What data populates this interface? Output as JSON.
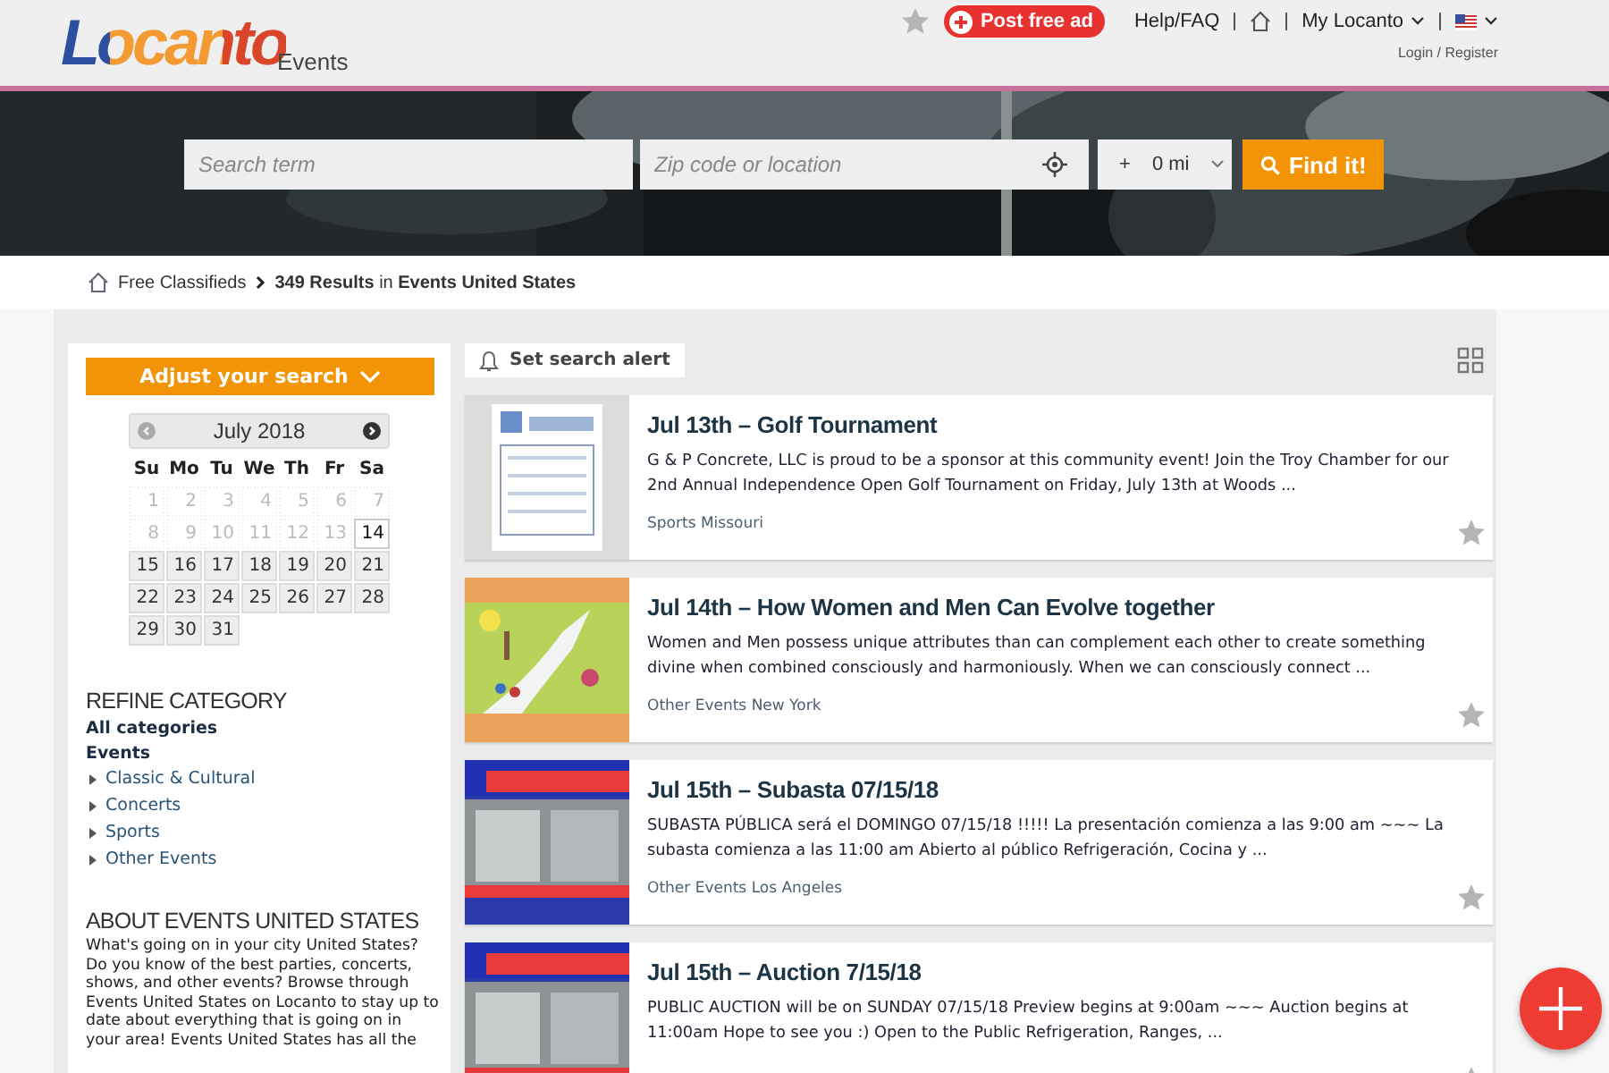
{
  "header": {
    "logo": "Locanto",
    "section": "Events",
    "post_button": "Post free ad",
    "help_link": "Help/FAQ",
    "account_menu": "My Locanto",
    "login_link": "Login / Register"
  },
  "search": {
    "term_placeholder": "Search term",
    "location_placeholder": "Zip code or location",
    "radius_prefix": "+",
    "radius": "0 mi",
    "button": "Find it!"
  },
  "breadcrumb": {
    "home": "Free Classifieds",
    "results": "**349 Results** in **Events United States**"
  },
  "sidebar": {
    "adjust_button": "Adjust your search",
    "calendar": {
      "month": "July 2018",
      "weekdays": [
        "Su",
        "Mo",
        "Tu",
        "We",
        "Th",
        "Fr",
        "Sa"
      ],
      "days": [
        {
          "label": "1",
          "disabled": true,
          "selected": false
        },
        {
          "label": "2",
          "disabled": true,
          "selected": false
        },
        {
          "label": "3",
          "disabled": true,
          "selected": false
        },
        {
          "label": "4",
          "disabled": true,
          "selected": false
        },
        {
          "label": "5",
          "disabled": true,
          "selected": false
        },
        {
          "label": "6",
          "disabled": true,
          "selected": false
        },
        {
          "label": "7",
          "disabled": true,
          "selected": false
        },
        {
          "label": "8",
          "disabled": true,
          "selected": false
        },
        {
          "label": "9",
          "disabled": true,
          "selected": false
        },
        {
          "label": "10",
          "disabled": true,
          "selected": false
        },
        {
          "label": "11",
          "disabled": true,
          "selected": false
        },
        {
          "label": "12",
          "disabled": true,
          "selected": false
        },
        {
          "label": "13",
          "disabled": true,
          "selected": false
        },
        {
          "label": "14",
          "disabled": false,
          "selected": true
        },
        {
          "label": "15",
          "disabled": false,
          "selected": false
        },
        {
          "label": "16",
          "disabled": false,
          "selected": false
        },
        {
          "label": "17",
          "disabled": false,
          "selected": false
        },
        {
          "label": "18",
          "disabled": false,
          "selected": false
        },
        {
          "label": "19",
          "disabled": false,
          "selected": false
        },
        {
          "label": "20",
          "disabled": false,
          "selected": false
        },
        {
          "label": "21",
          "disabled": false,
          "selected": false
        },
        {
          "label": "22",
          "disabled": false,
          "selected": false
        },
        {
          "label": "23",
          "disabled": false,
          "selected": false
        },
        {
          "label": "24",
          "disabled": false,
          "selected": false
        },
        {
          "label": "25",
          "disabled": false,
          "selected": false
        },
        {
          "label": "26",
          "disabled": false,
          "selected": false
        },
        {
          "label": "27",
          "disabled": false,
          "selected": false
        },
        {
          "label": "28",
          "disabled": false,
          "selected": false
        },
        {
          "label": "29",
          "disabled": false,
          "selected": false
        },
        {
          "label": "30",
          "disabled": false,
          "selected": false
        },
        {
          "label": "31",
          "disabled": false,
          "selected": false
        }
      ]
    },
    "refine_title": "REFINE CATEGORY",
    "categories": [
      {
        "label": "All categories"
      },
      {
        "label": "Events",
        "children": [
          {
            "label": "Classic & Cultural"
          },
          {
            "label": "Concerts"
          },
          {
            "label": "Sports"
          },
          {
            "label": "Other Events"
          }
        ]
      }
    ],
    "about_title": "ABOUT EVENTS UNITED STATES",
    "about_text": "What's going on in your city United States? Do you know of the best parties, concerts, shows, and other events? Browse through Events United States on Locanto to stay up to date about everything that is going on in your area! Events United States has all the"
  },
  "results": {
    "alert_button": "Set search alert",
    "listings": [
      {
        "title": "Jul 13th – Golf Tournament",
        "description": "G & P Concrete, LLC is proud to be a sponsor at this community event! Join the Troy Chamber for our 2nd Annual Independence Open Golf Tournament on Friday, July 13th at Woods ...",
        "location": "Sports Missouri",
        "favorite": false
      },
      {
        "title": "Jul 14th – How Women and Men Can Evolve together",
        "description": "Women and Men possess unique attributes than can complement each other to create something divine when combined consciously and harmoniously. When we can consciously connect ...",
        "location": "Other Events New York",
        "favorite": false
      },
      {
        "title": "Jul 15th – Subasta 07/15/18",
        "description": "SUBASTA PÚBLICA será el DOMINGO 07/15/18 !!!!! La presentación comienza a las 9:00 am ~~~ La subasta comienza a las 11:00 am Abierto al público Refrigeración, Cocina y ...",
        "location": "Other Events Los Angeles",
        "favorite": false
      },
      {
        "title": "Jul 15th – Auction 7/15/18",
        "description": "PUBLIC AUCTION will be on SUNDAY 07/15/18 Preview begins at 9:00am ~~~ Auction begins at 11:00am Hope to see you :) Open to the Public Refrigeration, Ranges, ...",
        "favorite": false
      }
    ]
  }
}
